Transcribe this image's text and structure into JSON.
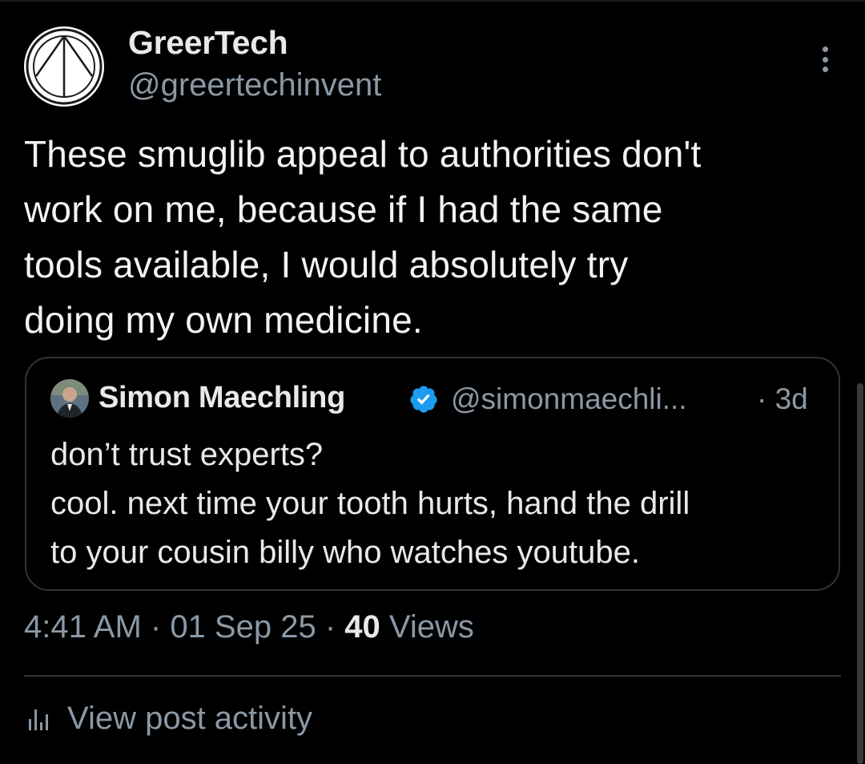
{
  "post": {
    "author": {
      "display_name": "GreerTech",
      "handle": "@greertechinvent",
      "avatar_icon": "delta-glyph-logo-avatar"
    },
    "menu_icon": "more-vertical-icon",
    "text": "These smuglib appeal to authorities don't\nwork on me, because if I had the same\ntools available, I would absolutely try\ndoing my own medicine.",
    "quote": {
      "display_name": "Simon Maechling",
      "verified_icon": "verified-badge-icon",
      "handle": "@simonmaechli...",
      "time": "· 3d",
      "text": "don’t trust experts?\ncool. next time your tooth hurts, hand the drill\nto your cousin billy who watches youtube."
    },
    "meta": {
      "time": "4:41 AM",
      "sep1": " · ",
      "date": "01 Sep 25",
      "sep2": " · ",
      "views_count": "40",
      "views_label": " Views"
    },
    "activity": {
      "icon": "bar-chart-icon",
      "label": "View post activity"
    }
  },
  "colors": {
    "background": "#000000",
    "primary_text": "#e7e9ea",
    "secondary_text": "#8b98a5",
    "border": "#2f3336",
    "verified": "#1d9bf0"
  }
}
